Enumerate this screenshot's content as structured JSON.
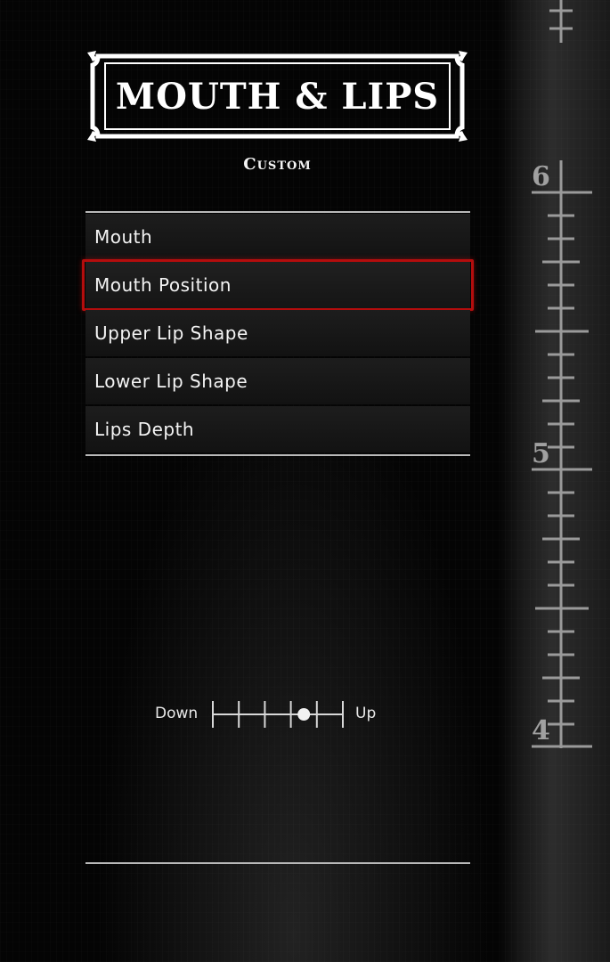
{
  "header": {
    "title": "MOUTH & LIPS",
    "subtitle": "Custom"
  },
  "menu": {
    "items": [
      {
        "label": "Mouth",
        "selected": false
      },
      {
        "label": "Mouth Position",
        "selected": true
      },
      {
        "label": "Upper Lip Shape",
        "selected": false
      },
      {
        "label": "Lower Lip Shape",
        "selected": false
      },
      {
        "label": "Lips Depth",
        "selected": false
      }
    ]
  },
  "slider": {
    "left_label": "Down",
    "right_label": "Up",
    "segments": 5,
    "selected_segment": 4
  },
  "ruler": {
    "labels": [
      "6",
      "5",
      "4"
    ]
  },
  "colors": {
    "selection_border": "#b40d0d",
    "text": "#f4f4f4"
  }
}
